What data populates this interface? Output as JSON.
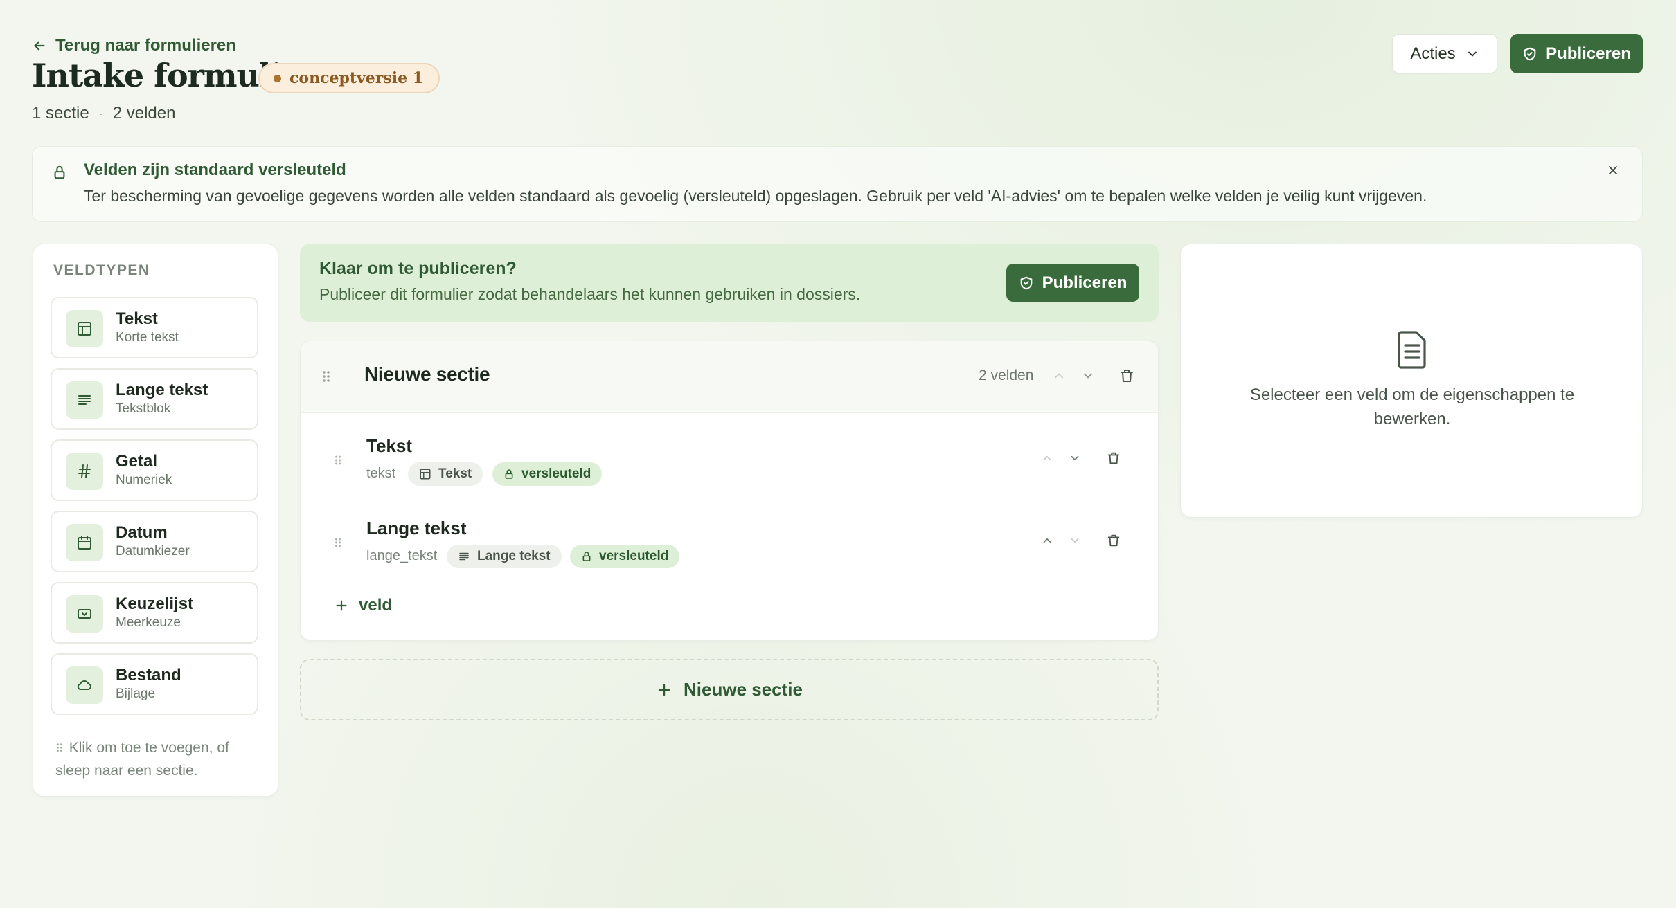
{
  "header": {
    "back_label": "Terug naar formulieren",
    "title": "Intake formulier",
    "badge": "conceptversie 1",
    "meta_sections": "1 sectie",
    "meta_separator": "·",
    "meta_fields": "2 velden",
    "actions_label": "Acties",
    "publish_label": "Publiceren"
  },
  "info_banner": {
    "title": "Velden zijn standaard versleuteld",
    "text": "Ter bescherming van gevoelige gegevens worden alle velden standaard als gevoelig (versleuteld) opgeslagen. Gebruik per veld 'AI-advies' om te bepalen welke velden je veilig kunt vrijgeven."
  },
  "palette": {
    "heading": "VELDTYPEN",
    "items": [
      {
        "name": "Tekst",
        "sub": "Korte tekst",
        "icon": "layout-icon"
      },
      {
        "name": "Lange tekst",
        "sub": "Tekstblok",
        "icon": "lines-icon"
      },
      {
        "name": "Getal",
        "sub": "Numeriek",
        "icon": "hash-icon"
      },
      {
        "name": "Datum",
        "sub": "Datumkiezer",
        "icon": "calendar-icon"
      },
      {
        "name": "Keuzelijst",
        "sub": "Meerkeuze",
        "icon": "select-icon"
      },
      {
        "name": "Bestand",
        "sub": "Bijlage",
        "icon": "cloud-icon"
      }
    ],
    "hint": "Klik om toe te voegen, of sleep naar een sectie."
  },
  "ready": {
    "title": "Klaar om te publiceren?",
    "text": "Publiceer dit formulier zodat behandelaars het kunnen gebruiken in dossiers.",
    "button": "Publiceren"
  },
  "section": {
    "title": "Nieuwe sectie",
    "count": "2 velden",
    "fields": [
      {
        "title": "Tekst",
        "key": "tekst",
        "type": "Tekst",
        "type_icon": "layout-icon",
        "badge": "versleuteld"
      },
      {
        "title": "Lange tekst",
        "key": "lange_tekst",
        "type": "Lange tekst",
        "type_icon": "lines-icon",
        "badge": "versleuteld"
      }
    ],
    "add_field": "veld"
  },
  "new_section_label": "Nieuwe sectie",
  "properties": {
    "empty_text": "Selecteer een veld om de eigenschappen te bewerken."
  },
  "colors": {
    "brand": "#3a6b3c",
    "accent_bg": "#deefd8",
    "draft_bg": "#fbeedd",
    "draft_text": "#8a5a22"
  }
}
